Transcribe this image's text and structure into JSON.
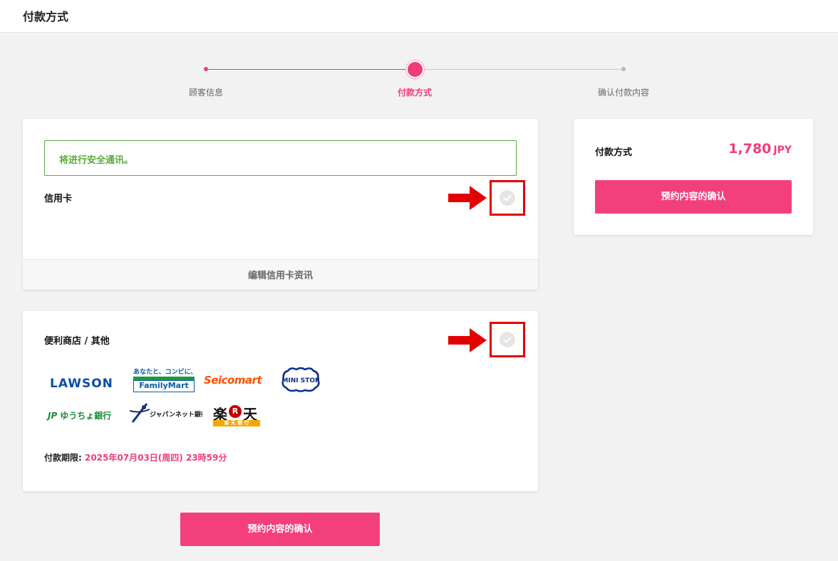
{
  "header": {
    "title": "付款方式"
  },
  "stepper": {
    "steps": [
      {
        "label": "顾客信息",
        "state": "done"
      },
      {
        "label": "付款方式",
        "state": "current"
      },
      {
        "label": "确认付款内容",
        "state": "todo"
      }
    ]
  },
  "credit_card": {
    "secure_notice": "将进行安全通讯。",
    "title": "信用卡",
    "edit_label": "编辑信用卡资讯"
  },
  "convenience": {
    "title": "便利商店 / 其他",
    "logos": {
      "lawson": "LAWSON",
      "familymart_top": "あなたと、コンビに、",
      "familymart": "FamilyMart",
      "seicomart": "Seicomart",
      "ministop": "MINI STOP",
      "yucho_mark": "JP",
      "yucho": "ゆうちょ銀行",
      "japannet": "ジャパンネット銀行",
      "rakuten_a": "楽",
      "rakuten_r": "R",
      "rakuten_b": "天",
      "rakuten_sub": "楽 天 銀 行"
    },
    "deadline_label": "付款期限:",
    "deadline_value": "2025年07月03日(周四) 23時59分"
  },
  "actions": {
    "confirm_label": "预约内容的确认"
  },
  "summary": {
    "label": "付款方式",
    "amount": "1,780",
    "currency": "JPY",
    "confirm_label": "预约内容的确认"
  },
  "colors": {
    "accent": "#f43f7d",
    "secure": "#5aaa3a",
    "highlight": "#e40000"
  }
}
